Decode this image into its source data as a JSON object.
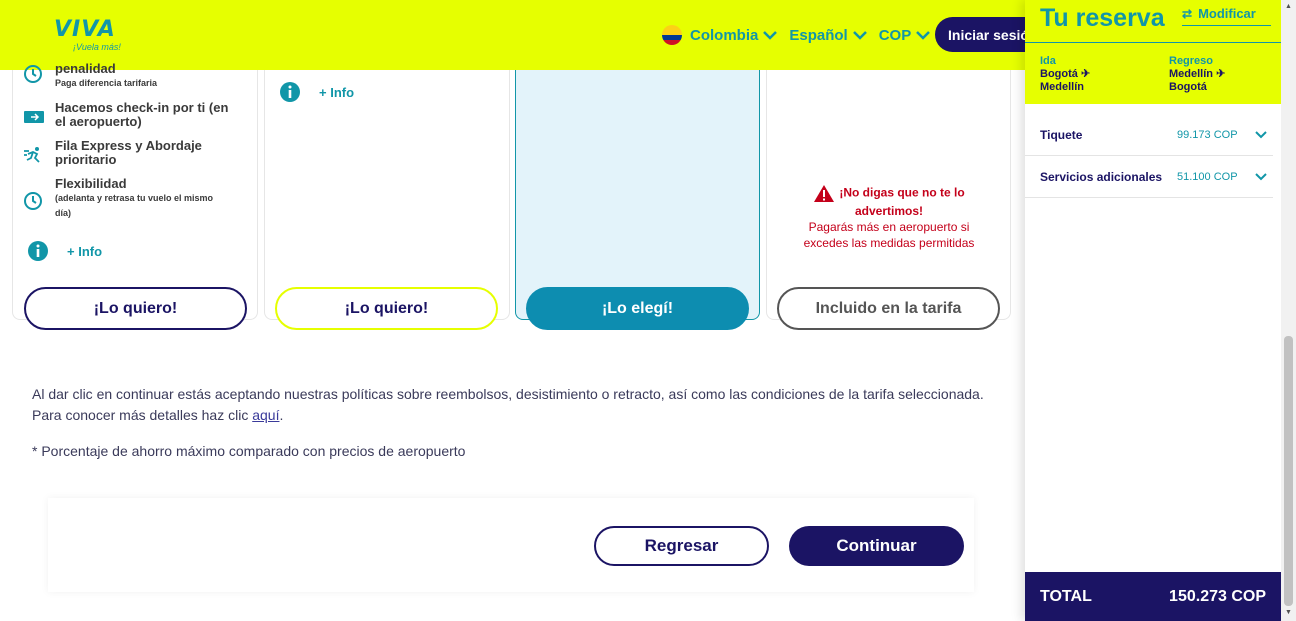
{
  "header": {
    "logo": "VIVA",
    "logo_tagline": "¡Vuela más!",
    "country": "Colombia",
    "language": "Español",
    "currency": "COP",
    "login": "Iniciar sesión"
  },
  "cards": [
    {
      "features": [
        {
          "title": "penalidad",
          "sub": "Paga diferencia tarifaria",
          "icon": "clock-icon"
        },
        {
          "title": "Hacemos check-in por ti (en el aeropuerto)",
          "sub": "",
          "icon": "boarding-pass-icon"
        },
        {
          "title": "Fila Express y Abordaje prioritario",
          "sub": "",
          "icon": "running-person-icon"
        },
        {
          "title": "Flexibilidad",
          "sub": "(adelanta y retrasa tu vuelo el mismo día)",
          "icon": "clock-icon"
        }
      ],
      "info": "+ Info",
      "button": "¡Lo quiero!"
    },
    {
      "info": "+ Info",
      "button": "¡Lo quiero!"
    },
    {
      "button": "¡Lo elegí!"
    },
    {
      "warning_title": "¡No digas que no te lo advertimos!",
      "warning_text": "Pagarás más en aeropuerto si excedes las medidas permitidas",
      "button": "Incluido en la tarifa"
    }
  ],
  "policy": {
    "text": "Al dar clic en continuar estás aceptando nuestras políticas sobre reembolsos, desistimiento o retracto, así como las condiciones de la tarifa seleccionada. Para conocer más detalles haz clic ",
    "link": "aquí",
    "end": "."
  },
  "note": "* Porcentaje de ahorro máximo comparado con precios de aeropuerto",
  "actions": {
    "back": "Regresar",
    "next": "Continuar"
  },
  "sidebar": {
    "title": "Tu reserva",
    "modify": "Modificar",
    "outbound": {
      "label": "Ida",
      "from": "Bogotá",
      "to": "Medellín"
    },
    "return": {
      "label": "Regreso",
      "from": "Medellín",
      "to": "Bogotá"
    },
    "rows": [
      {
        "name": "Tiquete",
        "value": "99.173 COP"
      },
      {
        "name": "Servicios adicionales",
        "value": "51.100 COP"
      }
    ],
    "total_label": "TOTAL",
    "total_value": "150.273 COP"
  },
  "colors": {
    "brand_yellow": "#e6ff00",
    "brand_teal": "#1196a8",
    "brand_navy": "#1b1464",
    "warning_red": "#c4001a"
  }
}
